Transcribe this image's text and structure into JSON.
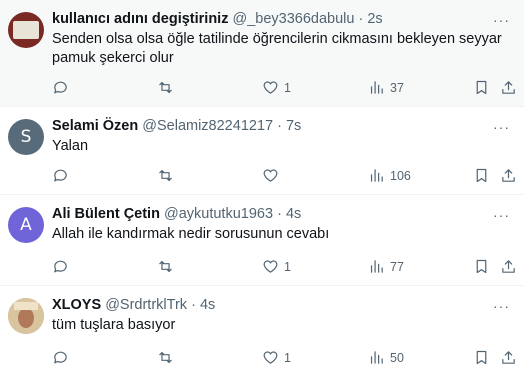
{
  "tweets": [
    {
      "name": "kullanıcı adını degiştiriniz",
      "handle": "@_bey3366dabulu",
      "dot": "·",
      "time": "2s",
      "text": "Senden olsa olsa öğle tatilinde öğrencilerin cikmasını bekleyen seyyar pamuk şekerci olur",
      "likes": "1",
      "views": "37",
      "avatar_letter": "",
      "avatar_color": "#7a2a22"
    },
    {
      "name": "Selami Özen",
      "handle": "@Selamiz82241217",
      "dot": "·",
      "time": "7s",
      "text": "Yalan",
      "likes": "",
      "views": "106",
      "avatar_letter": "S",
      "avatar_color": "#576b7b"
    },
    {
      "name": "Ali Bülent Çetin",
      "handle": "@aykututku1963",
      "dot": "·",
      "time": "4s",
      "text": "Allah ile kandırmak nedir sorusunun cevabı",
      "likes": "1",
      "views": "77",
      "avatar_letter": "A",
      "avatar_color": "#6f64d8"
    },
    {
      "name": "XLOYS",
      "handle": "@SrdrtrklTrk",
      "dot": "·",
      "time": "4s",
      "text": "tüm tuşlara basıyor",
      "likes": "1",
      "views": "50",
      "avatar_letter": "",
      "avatar_color": "#c9b08a"
    }
  ],
  "icons": {
    "reply": "reply-icon",
    "retweet": "retweet-icon",
    "like": "heart-icon",
    "views": "views-icon",
    "bookmark": "bookmark-icon",
    "share": "share-icon",
    "more": "more-icon"
  }
}
